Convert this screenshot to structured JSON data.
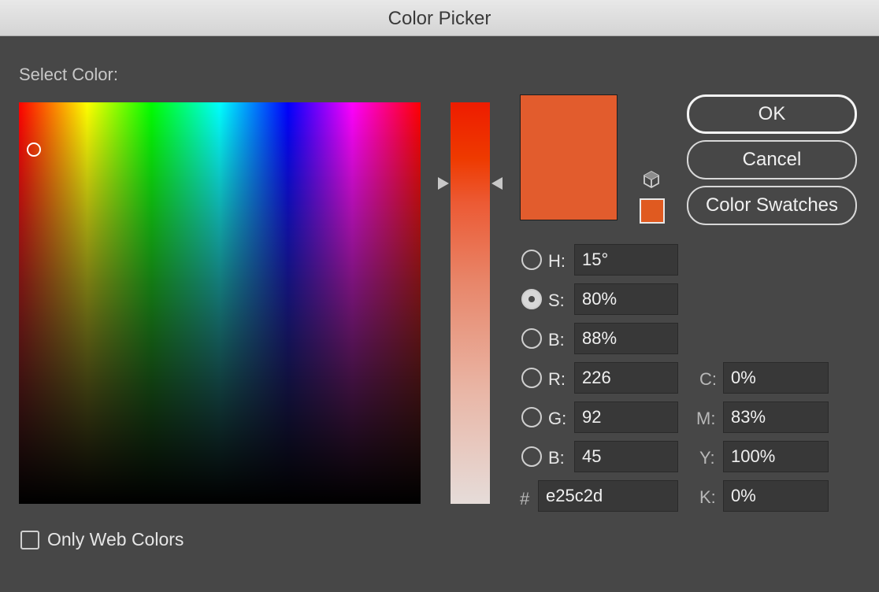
{
  "window": {
    "title": "Color Picker"
  },
  "picker": {
    "select_label": "Select Color:",
    "current_color": "#e25c2d",
    "websafe_color": "#e05a20"
  },
  "buttons": {
    "ok": "OK",
    "cancel": "Cancel",
    "swatches": "Color Swatches"
  },
  "hsb": {
    "h": {
      "label": "H:",
      "value": "15°"
    },
    "s": {
      "label": "S:",
      "value": "80%"
    },
    "b": {
      "label": "B:",
      "value": "88%"
    }
  },
  "rgb": {
    "r": {
      "label": "R:",
      "value": "226"
    },
    "g": {
      "label": "G:",
      "value": "92"
    },
    "b": {
      "label": "B:",
      "value": "45"
    }
  },
  "hex": {
    "label": "#",
    "value": "e25c2d"
  },
  "cmyk": {
    "c": {
      "label": "C:",
      "value": "0%"
    },
    "m": {
      "label": "M:",
      "value": "83%"
    },
    "y": {
      "label": "Y:",
      "value": "100%"
    },
    "k": {
      "label": "K:",
      "value": "0%"
    }
  },
  "options": {
    "web_colors_label": "Only Web Colors",
    "web_colors_checked": false
  },
  "icons": {
    "cube": "cube-icon"
  }
}
